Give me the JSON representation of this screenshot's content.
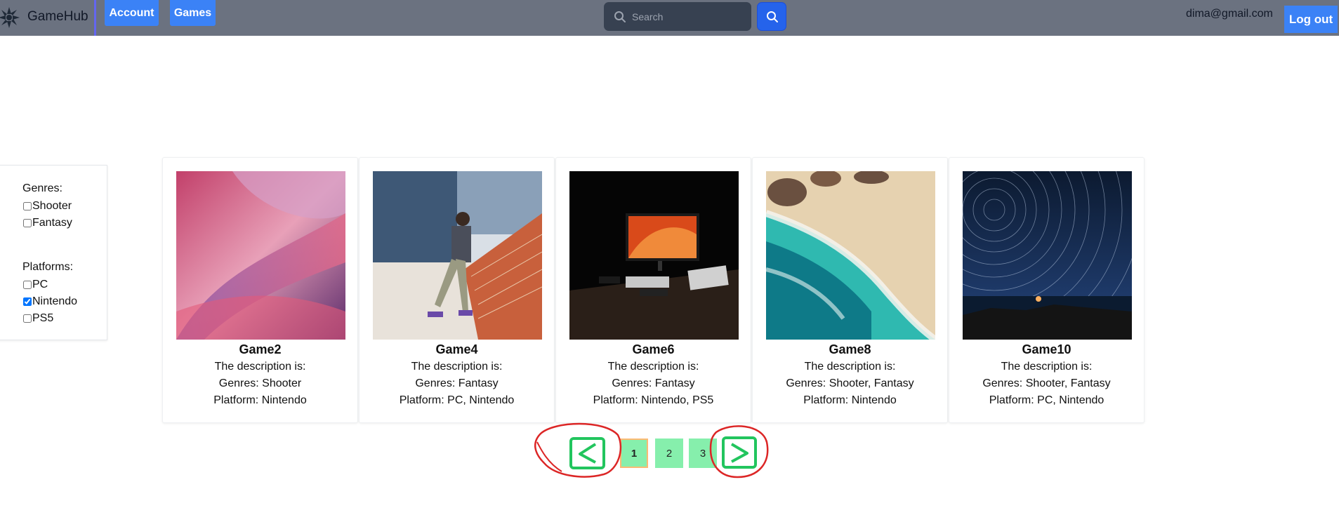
{
  "app": {
    "name": "GameHub"
  },
  "nav": {
    "account_label": "Account",
    "games_label": "Games"
  },
  "search": {
    "placeholder": "Search"
  },
  "user": {
    "email": "dima@gmail.com",
    "logout_label": "Log out"
  },
  "filters": {
    "genres_heading": "Genres:",
    "genres": [
      {
        "label": "Shooter",
        "checked": false
      },
      {
        "label": "Fantasy",
        "checked": false
      }
    ],
    "platforms_heading": "Platforms:",
    "platforms": [
      {
        "label": "PC",
        "checked": false
      },
      {
        "label": "Nintendo",
        "checked": true
      },
      {
        "label": "PS5",
        "checked": false
      }
    ]
  },
  "games": [
    {
      "title": "Game2",
      "description": "The description is:",
      "genres": "Genres: Shooter",
      "platform": "Platform: Nintendo",
      "image": "abstract-pink-waves"
    },
    {
      "title": "Game4",
      "description": "The description is:",
      "genres": "Genres: Fantasy",
      "platform": "Platform: PC, Nintendo",
      "image": "person-on-brick-wall"
    },
    {
      "title": "Game6",
      "description": "The description is:",
      "genres": "Genres: Fantasy",
      "platform": "Platform: Nintendo, PS5",
      "image": "desk-setup-monitor"
    },
    {
      "title": "Game8",
      "description": "The description is:",
      "genres": "Genres: Shooter, Fantasy",
      "platform": "Platform: Nintendo",
      "image": "aerial-beach-waves"
    },
    {
      "title": "Game10",
      "description": "The description is:",
      "genres": "Genres: Shooter, Fantasy",
      "platform": "Platform: PC, Nintendo",
      "image": "star-trails-night-sky"
    }
  ],
  "pagination": {
    "prev_label": "<",
    "next_label": ">",
    "pages": [
      "1",
      "2",
      "3"
    ],
    "current": "1"
  },
  "colors": {
    "navbar": "#6b7280",
    "accent": "#3b82f6",
    "page_button": "#86efac",
    "annotation_red": "#dc2626",
    "annotation_green": "#22c55e"
  }
}
